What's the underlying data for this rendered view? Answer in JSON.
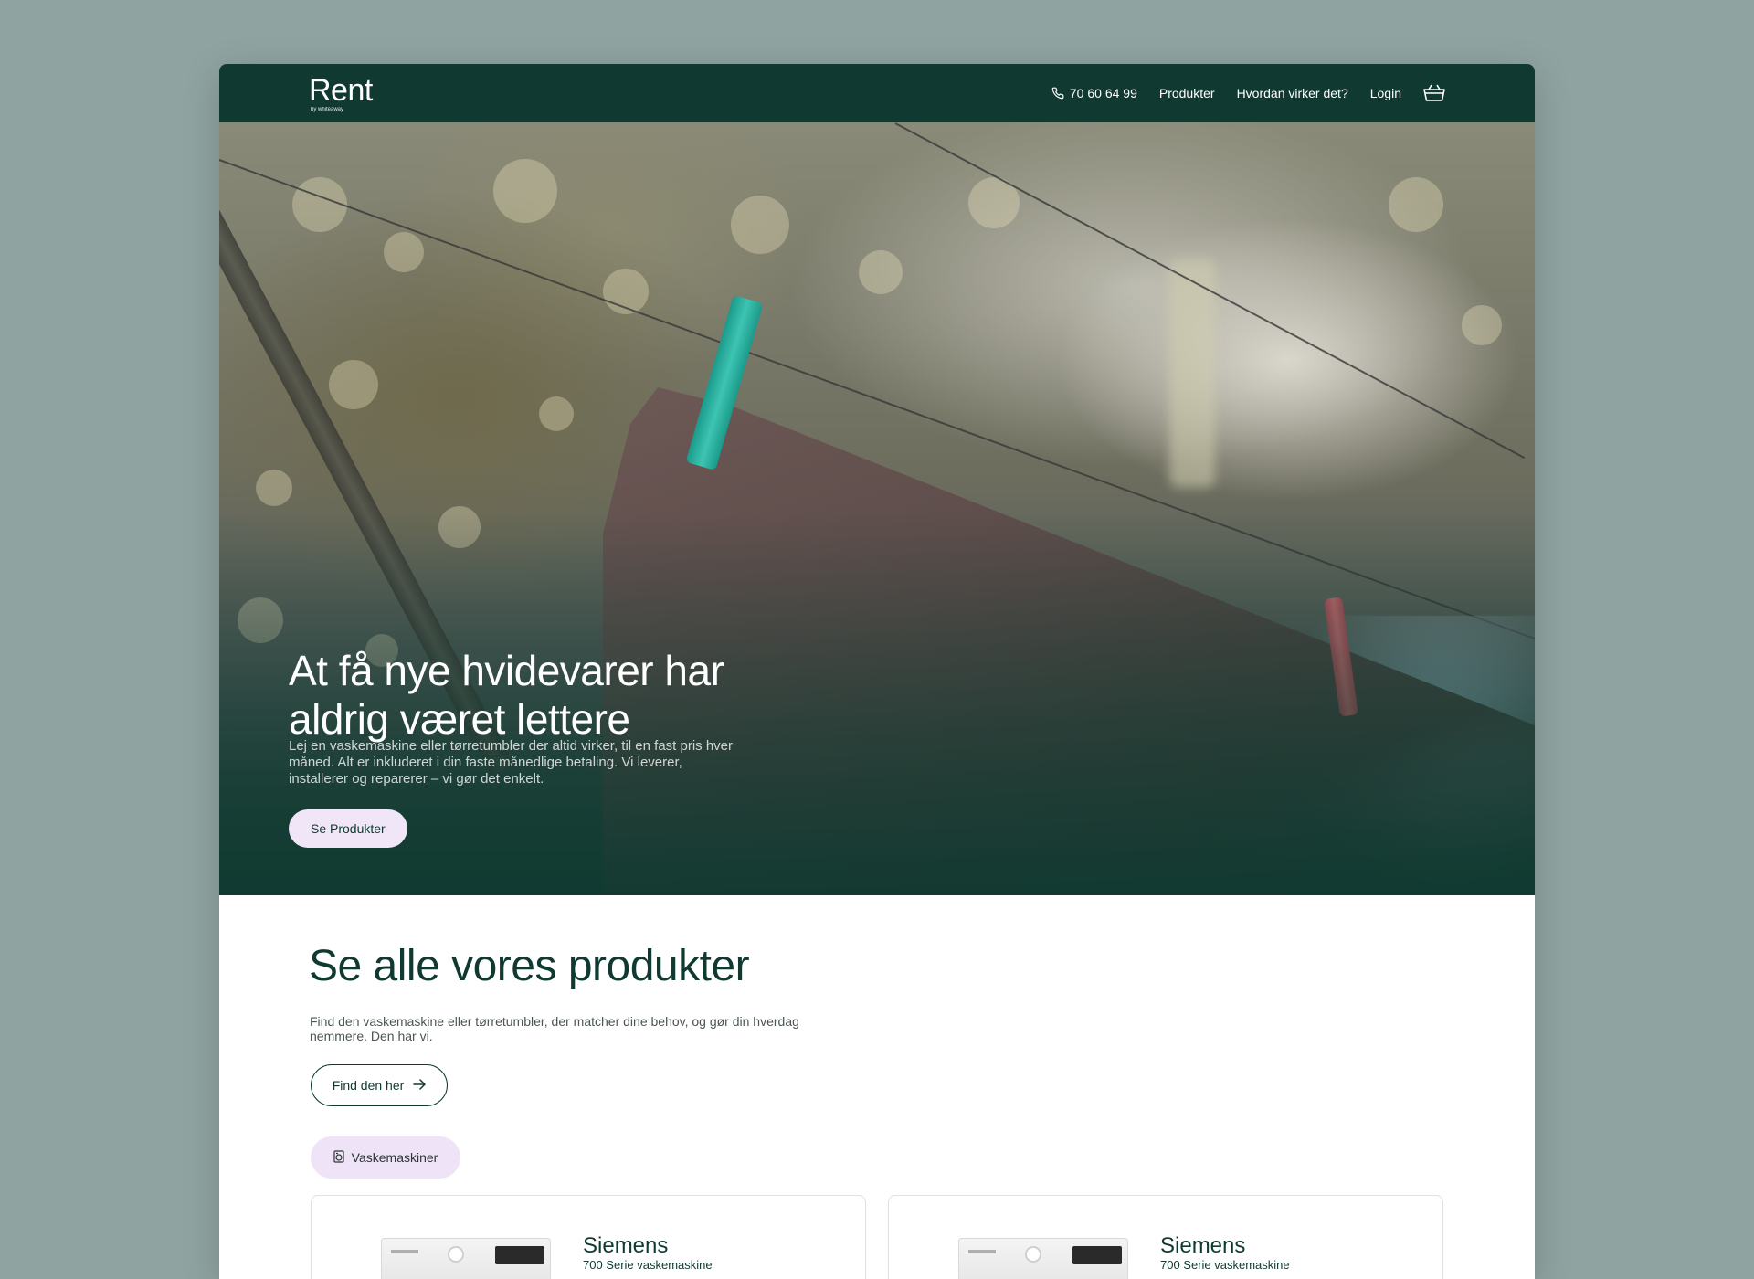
{
  "nav": {
    "logo": "Rent",
    "logo_sub": "by whiteaway",
    "phone": "70 60 64 99",
    "links": [
      "Produkter",
      "Hvordan virker det?",
      "Login"
    ]
  },
  "hero": {
    "title": "At få nye hvidevarer har aldrig været lettere",
    "text": "Lej en vaskemaskine eller tørretumbler der altid virker, til en fast pris hver måned. Alt er inkluderet i din faste månedlige betaling. Vi leverer, installerer og reparerer – vi gør det enkelt.",
    "cta": "Se Produkter"
  },
  "products": {
    "title": "Se alle vores produkter",
    "text": "Find den vaskemaskine eller tørretumbler, der matcher dine behov, og gør din hverdag nemmere. Den har vi.",
    "find_button": "Find den her",
    "chip": "Vaskemaskiner",
    "cards": [
      {
        "brand": "Siemens",
        "model": "700 Serie vaskemaskine"
      },
      {
        "brand": "Siemens",
        "model": "700 Serie vaskemaskine"
      }
    ]
  },
  "colors": {
    "brand_green": "#103a31",
    "lavender": "#f1e6f7",
    "page_bg": "#8fa3a1"
  }
}
